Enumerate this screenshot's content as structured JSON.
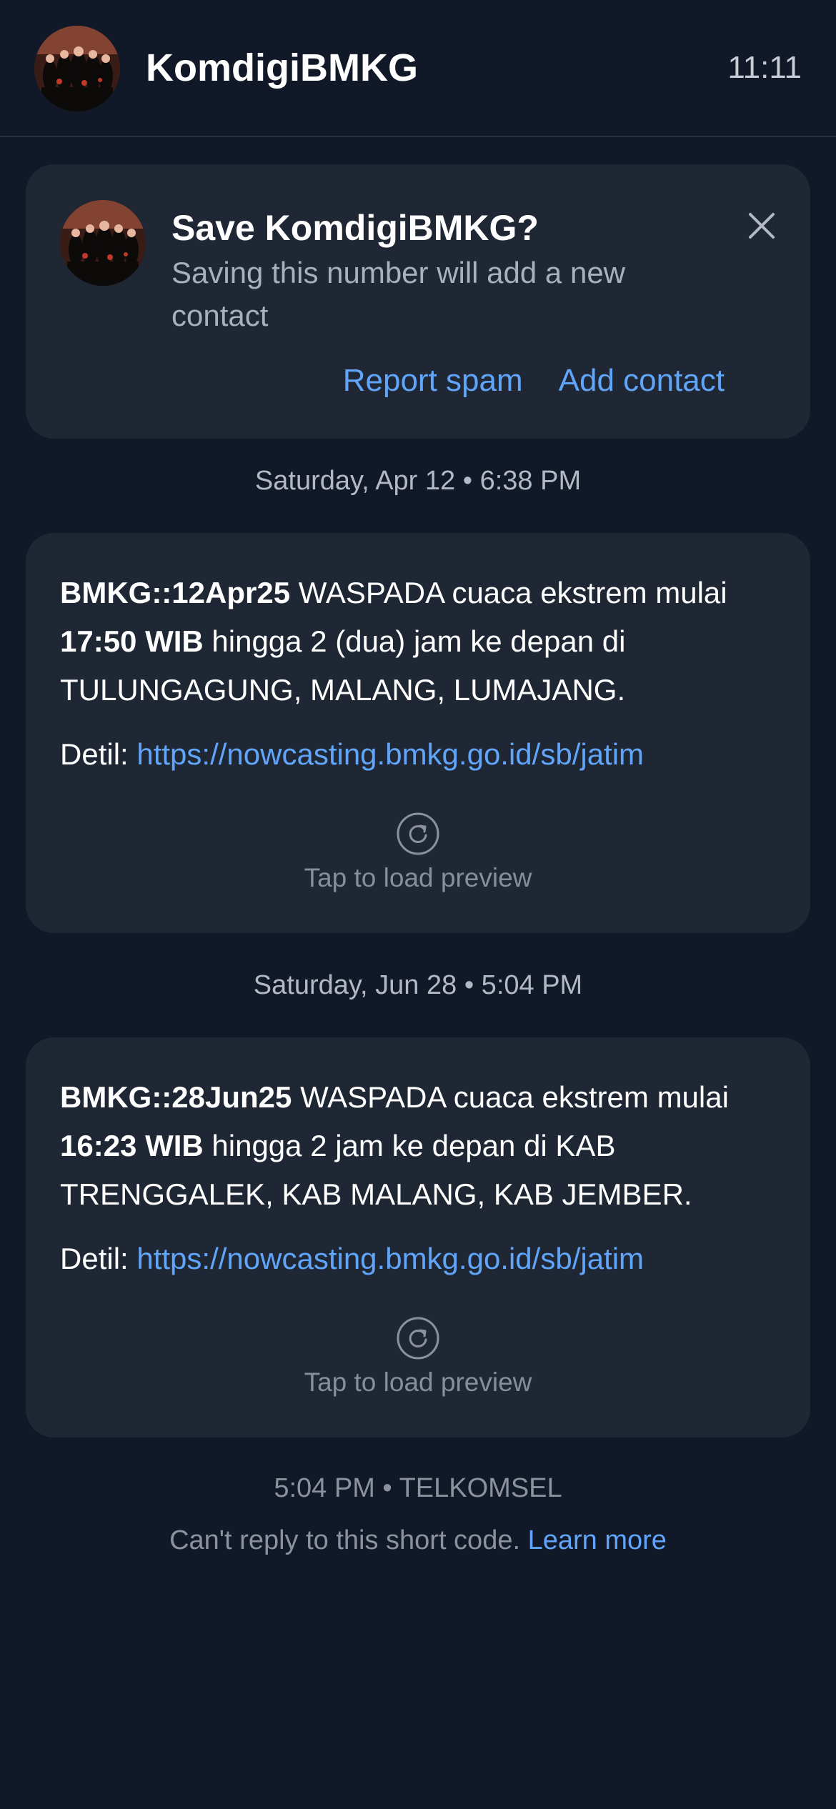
{
  "header": {
    "title": "KomdigiBMKG",
    "time": "11:11"
  },
  "save_prompt": {
    "title": "Save KomdigiBMKG?",
    "subtitle": "Saving this number will add a new contact",
    "report_spam": "Report spam",
    "add_contact": "Add contact"
  },
  "messages": [
    {
      "date": "Saturday, Apr 12 • 6:38 PM",
      "bold_prefix": "BMKG::12Apr25",
      "text_1": " WASPADA cuaca ekstrem mulai ",
      "bold_time": "17:50 WIB",
      "text_2": " hingga 2 (dua) jam ke depan di TULUNGAGUNG, MALANG, LUMAJANG.",
      "detail_label": "Detil: ",
      "url": "https://nowcasting.bmkg.go.id/sb/jatim",
      "preview_label": "Tap to load preview"
    },
    {
      "date": "Saturday, Jun 28 • 5:04 PM",
      "bold_prefix": "BMKG::28Jun25",
      "text_1": " WASPADA cuaca ekstrem mulai ",
      "bold_time": "16:23 WIB",
      "text_2": " hingga 2 jam ke depan di KAB TRENGGALEK, KAB MALANG, KAB JEMBER.",
      "detail_label": "Detil: ",
      "url": "https://nowcasting.bmkg.go.id/sb/jatim",
      "preview_label": "Tap to load preview"
    }
  ],
  "footer": {
    "meta": "5:04 PM • TELKOMSEL",
    "note": "Can't reply to this short code. ",
    "learn_more": "Learn more"
  },
  "colors": {
    "background": "#111827",
    "card": "#1f2735",
    "link": "#60a5fa"
  }
}
